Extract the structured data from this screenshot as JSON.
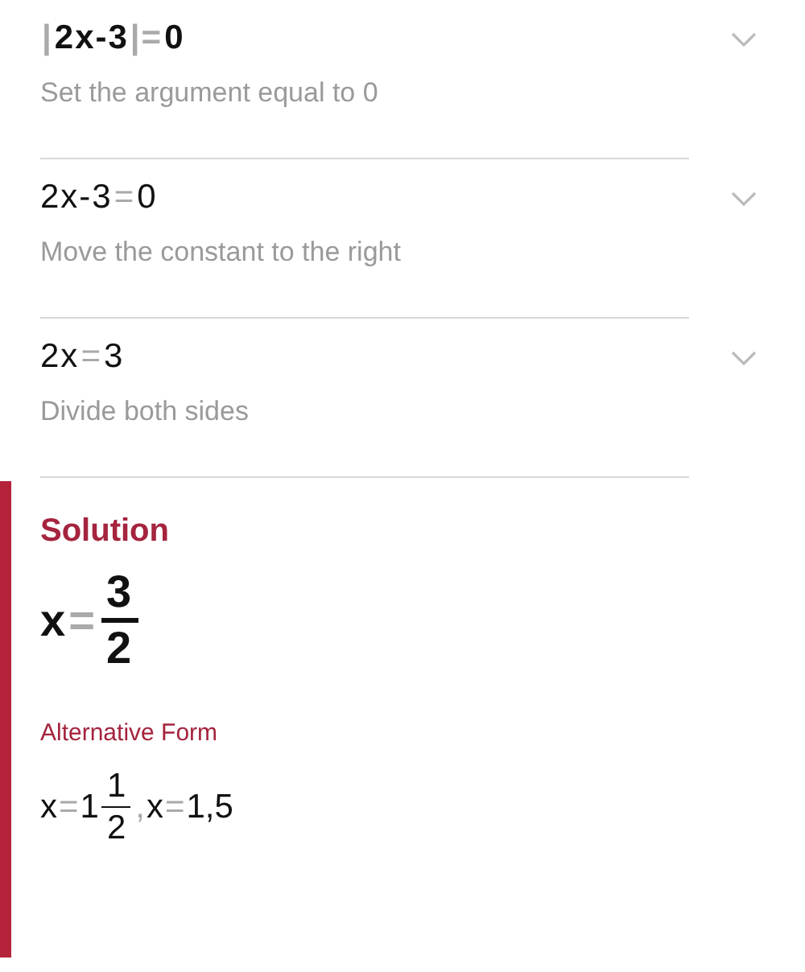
{
  "steps": [
    {
      "expression": [
        {
          "kind": "op",
          "text": "|"
        },
        {
          "kind": "term",
          "text": "2x-3"
        },
        {
          "kind": "op",
          "text": "|="
        },
        {
          "kind": "term",
          "text": "0"
        }
      ],
      "bold": true,
      "hint": "Set the argument equal to 0",
      "expanded": false
    },
    {
      "expression": [
        {
          "kind": "term",
          "text": "2x-3"
        },
        {
          "kind": "op",
          "text": "="
        },
        {
          "kind": "term",
          "text": "0"
        }
      ],
      "bold": false,
      "hint": "Move the constant to the right",
      "expanded": false
    },
    {
      "expression": [
        {
          "kind": "term",
          "text": "2x"
        },
        {
          "kind": "op",
          "text": "="
        },
        {
          "kind": "term",
          "text": "3"
        }
      ],
      "bold": false,
      "hint": "Divide both sides",
      "expanded": false
    }
  ],
  "solution": {
    "title": "Solution",
    "expression": [
      {
        "kind": "term",
        "text": "x"
      },
      {
        "kind": "op",
        "text": "="
      },
      {
        "kind": "fraction",
        "numerator": "3",
        "denominator": "2"
      }
    ],
    "alternative_title": "Alternative Form",
    "alternative": [
      {
        "kind": "term",
        "text": "x"
      },
      {
        "kind": "op",
        "text": "="
      },
      {
        "kind": "term",
        "text": "1"
      },
      {
        "kind": "fraction",
        "numerator": "1",
        "denominator": "2"
      },
      {
        "kind": "op",
        "text": ","
      },
      {
        "kind": "term",
        "text": "x"
      },
      {
        "kind": "op",
        "text": "="
      },
      {
        "kind": "term",
        "text": "1,5"
      }
    ]
  }
}
